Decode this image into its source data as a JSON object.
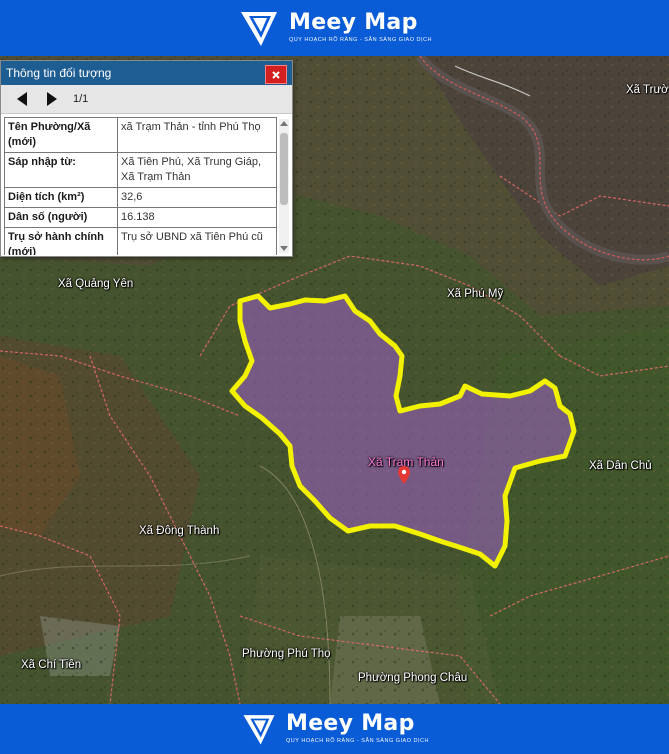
{
  "brand": {
    "name": "Meey Map",
    "tagline": "QUY HOẠCH RÕ RÀNG - SẴN SÀNG GIAO DỊCH"
  },
  "panel": {
    "title": "Thông tin đối tượng",
    "page": "1/1",
    "rows": [
      {
        "key": "Tên Phường/Xã (mới)",
        "value": "xã Trạm Thản - tỉnh Phú Thọ"
      },
      {
        "key": "Sáp nhập từ:",
        "value": "Xã Tiên Phú, Xã Trung Giáp, Xã Trạm Thản"
      },
      {
        "key": "Diện tích (km²)",
        "value": "32,6"
      },
      {
        "key": "Dân số (người)",
        "value": "16.138"
      },
      {
        "key": "Trụ sở hành chính (mới)",
        "value": "Trụ sở UBND xã Tiên Phú cũ"
      }
    ]
  },
  "map": {
    "highlight": "Xã Trạm Thản",
    "labels": {
      "quang_yen": "Xã Quảng Yên",
      "phu_my": "Xã Phú Mỹ",
      "dan_chu": "Xã Dân Chủ",
      "dong_thanh": "Xã Đông Thành",
      "chi_tien": "Xã Chí Tiên",
      "phu_tho": "Phường Phú Thọ",
      "phong_chau": "Phường Phong Châu",
      "truong": "Xã Trườ"
    },
    "colors": {
      "highlight_border": "#f2f200",
      "highlight_fill": "#a060c8",
      "brand": "#0a5bd6"
    }
  }
}
